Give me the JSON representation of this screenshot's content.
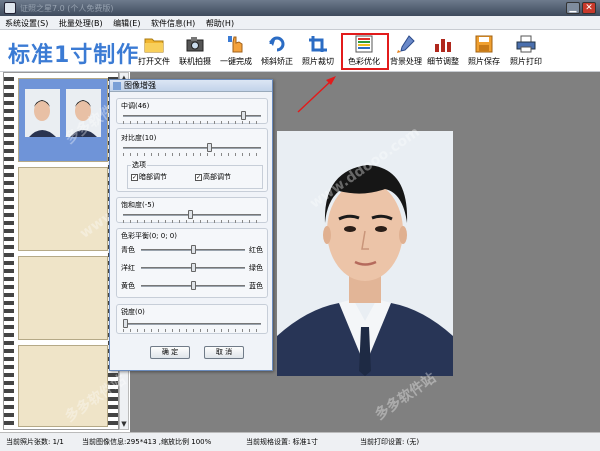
{
  "window": {
    "title": "证照之星7.0 (个人免费版)",
    "close_glyph": "✕",
    "minimize_glyph": "▁"
  },
  "menu": [
    {
      "label": "系统设置(S)"
    },
    {
      "label": "批量处理(B)"
    },
    {
      "label": "编辑(E)"
    },
    {
      "label": "软件信息(H)"
    },
    {
      "label": "帮助(H)"
    }
  ],
  "toolbar": {
    "app_title": "标准1寸制作",
    "buttons": [
      {
        "label": "打开文件",
        "icon": "folder-icon"
      },
      {
        "label": "联机拍摄",
        "icon": "camera-icon"
      },
      {
        "label": "一键完成",
        "icon": "hand-icon"
      },
      {
        "label": "倾斜矫正",
        "icon": "rotate-icon"
      },
      {
        "label": "照片裁切",
        "icon": "crop-icon"
      },
      {
        "label": "色彩优化",
        "icon": "color-bars-icon"
      },
      {
        "label": "背景处理",
        "icon": "brush-icon"
      },
      {
        "label": "细节调整",
        "icon": "detail-icon"
      },
      {
        "label": "照片保存",
        "icon": "save-icon"
      },
      {
        "label": "照片打印",
        "icon": "printer-icon"
      }
    ]
  },
  "dialog": {
    "title": "图像增强",
    "midtone": {
      "label": "中调(46)",
      "value": 46
    },
    "contrast": {
      "label": "对比度(10)",
      "value": 10
    },
    "options_label": "选项",
    "checkbox_dark": {
      "label": "暗部调节",
      "checked": true
    },
    "checkbox_light": {
      "label": "高部调节",
      "checked": true
    },
    "saturation": {
      "label": "饱和度(-5)",
      "value": -5
    },
    "color_balance_label": "色彩平衡(0; 0; 0)",
    "balance_rows": [
      {
        "left": "青色",
        "right": "红色",
        "value": 0
      },
      {
        "left": "洋红",
        "right": "绿色",
        "value": 0
      },
      {
        "left": "黄色",
        "right": "蓝色",
        "value": 0
      }
    ],
    "sharpness": {
      "label": "锐度(0)",
      "value": 0
    },
    "ok_label": "确 定",
    "cancel_label": "取 消"
  },
  "watermarks": [
    "www.ddooo.com",
    "www.ddooo.com",
    "多多软件站",
    "多多软件站",
    "多多软件站"
  ],
  "status": {
    "count": "当前照片张数: 1/1",
    "info": "当前图像信息:295*413 ,缩放比例 100%",
    "spec": "当前规格设置: 标准1寸",
    "print": "当前打印设置: (无)"
  },
  "colors": {
    "accent": "#3b7bd4",
    "highlight": "#e21b1b",
    "workspace": "#808080"
  }
}
